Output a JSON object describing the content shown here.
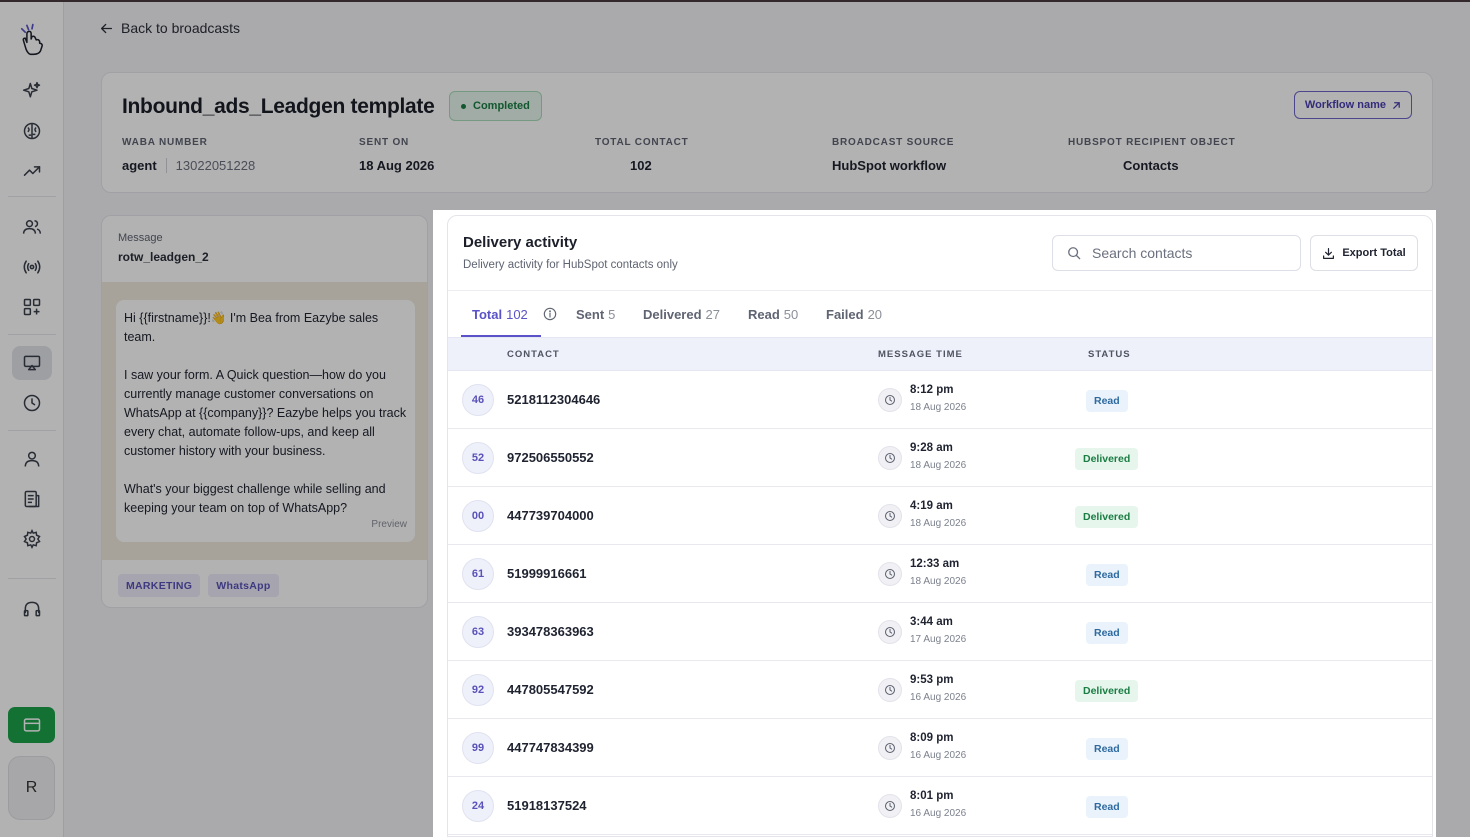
{
  "back_label": "Back to broadcasts",
  "broadcast": {
    "title": "Inbound_ads_Leadgen template",
    "status": "Completed",
    "workflow_button": "Workflow name",
    "meta": [
      {
        "label": "WABA NUMBER",
        "value": "agent",
        "sub": "13022051228"
      },
      {
        "label": "SENT ON",
        "value": "18 Aug 2026"
      },
      {
        "label": "TOTAL CONTACT",
        "value": "102"
      },
      {
        "label": "BROADCAST SOURCE",
        "value": "HubSpot workflow"
      },
      {
        "label": "HUBSPOT RECIPIENT OBJECT",
        "value": "Contacts"
      }
    ]
  },
  "message": {
    "label": "Message",
    "template_name": "rotw_leadgen_2",
    "body": "Hi {{firstname}}!👋 I'm Bea from Eazybe sales team.\n\nI saw your form. A Quick question—how do you currently manage customer conversations on WhatsApp at {{company}}? Eazybe helps you track every chat, automate follow-ups, and keep all customer history with your business.\n\nWhat's your biggest challenge while selling and keeping your team on top of WhatsApp?",
    "preview_label": "Preview",
    "tags": [
      "MARKETING",
      "WhatsApp"
    ]
  },
  "delivery": {
    "title": "Delivery activity",
    "subtitle": "Delivery activity for HubSpot contacts only",
    "search_placeholder": "Search contacts",
    "export_label": "Export Total",
    "tabs": [
      {
        "label": "Total",
        "count": "102"
      },
      {
        "label": "Sent",
        "count": "5"
      },
      {
        "label": "Delivered",
        "count": "27"
      },
      {
        "label": "Read",
        "count": "50"
      },
      {
        "label": "Failed",
        "count": "20"
      }
    ],
    "columns": [
      "CONTACT",
      "MESSAGE TIME",
      "STATUS"
    ],
    "rows": [
      {
        "initials": "46",
        "contact": "5218112304646",
        "time": "8:12 pm",
        "date": "18 Aug 2026",
        "status": "Read"
      },
      {
        "initials": "52",
        "contact": "972506550552",
        "time": "9:28 am",
        "date": "18 Aug 2026",
        "status": "Delivered"
      },
      {
        "initials": "00",
        "contact": "447739704000",
        "time": "4:19 am",
        "date": "18 Aug 2026",
        "status": "Delivered"
      },
      {
        "initials": "61",
        "contact": "51999916661",
        "time": "12:33 am",
        "date": "18 Aug 2026",
        "status": "Read"
      },
      {
        "initials": "63",
        "contact": "393478363963",
        "time": "3:44 am",
        "date": "17 Aug 2026",
        "status": "Read"
      },
      {
        "initials": "92",
        "contact": "447805547592",
        "time": "9:53 pm",
        "date": "16 Aug 2026",
        "status": "Delivered"
      },
      {
        "initials": "99",
        "contact": "447747834399",
        "time": "8:09 pm",
        "date": "16 Aug 2026",
        "status": "Read"
      },
      {
        "initials": "24",
        "contact": "51918137524",
        "time": "8:01 pm",
        "date": "16 Aug 2026",
        "status": "Read"
      }
    ]
  },
  "sidebar": {
    "avatar_alt": "R",
    "icons": [
      "sparkle-icon",
      "brain-icon",
      "trending-up-icon",
      "users-icon",
      "broadcast-icon",
      "add-widget-icon",
      "monitor-icon",
      "clock-icon",
      "user-icon",
      "document-icon",
      "gear-icon",
      "headset-icon"
    ]
  },
  "colors": {
    "accent": "#5a52c8",
    "success": "#1a7d43",
    "read": "#2e6aa0",
    "billing_green": "#1aa34a"
  }
}
